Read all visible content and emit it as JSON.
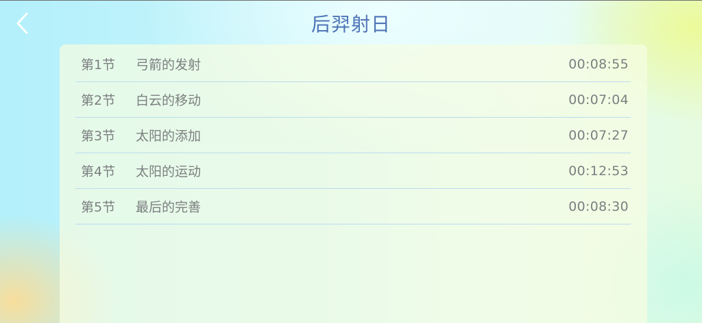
{
  "header": {
    "title": "后羿射日",
    "back_icon": "chevron-left-icon"
  },
  "lessons": [
    {
      "number": "第1节",
      "title": "弓箭的发射",
      "duration": "00:08:55"
    },
    {
      "number": "第2节",
      "title": "白云的移动",
      "duration": "00:07:04"
    },
    {
      "number": "第3节",
      "title": "太阳的添加",
      "duration": "00:07:27"
    },
    {
      "number": "第4节",
      "title": "太阳的运动",
      "duration": "00:12:53"
    },
    {
      "number": "第5节",
      "title": "最后的完善",
      "duration": "00:08:30"
    }
  ],
  "colors": {
    "title": "#4f74b6",
    "row_text": "#7b7f80",
    "divider": "#b9dcee"
  }
}
